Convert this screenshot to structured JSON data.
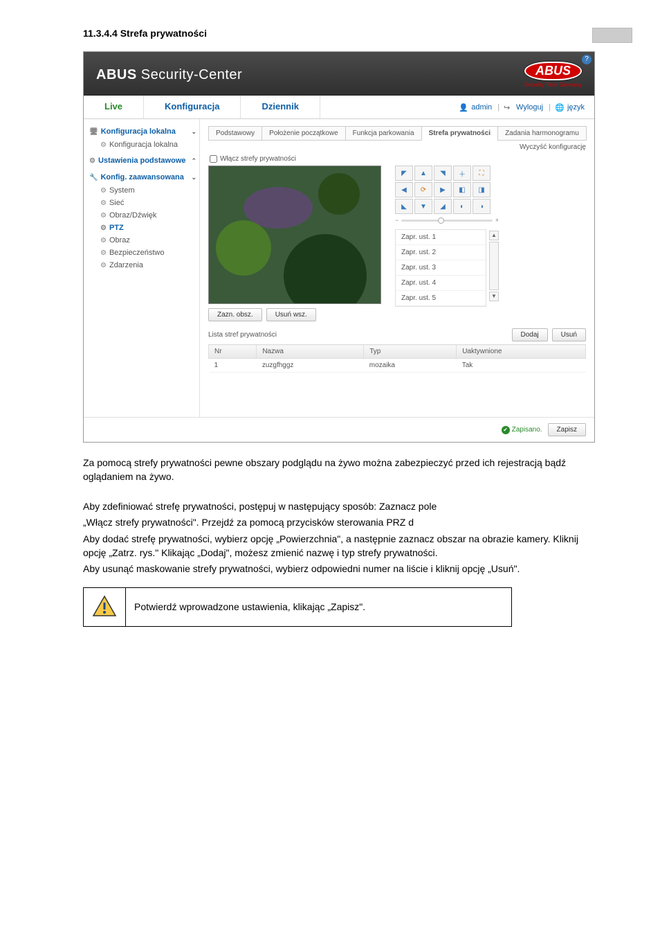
{
  "section_number": "11.3.4.4",
  "section_title": "Strefa prywatności",
  "app": {
    "brand_bold": "ABUS",
    "brand_rest": " Security-Center",
    "logo_text": "ABUS",
    "logo_sub": "Security Tech Germany"
  },
  "topnav": {
    "live": "Live",
    "config": "Konfiguracja",
    "journal": "Dziennik",
    "user": "admin",
    "logout": "Wyloguj",
    "language": "język"
  },
  "sidebar": {
    "local_cfg_head": "Konfiguracja lokalna",
    "local_cfg_item": "Konfiguracja lokalna",
    "basic_head": "Ustawienia podstawowe",
    "adv_head": "Konfig. zaawansowana",
    "adv_items": {
      "system": "System",
      "net": "Sieć",
      "imgsnd": "Obraz/Dźwięk",
      "ptz": "PTZ",
      "image": "Obraz",
      "security": "Bezpieczeństwo",
      "events": "Zdarzenia"
    }
  },
  "subtabs": {
    "basic": "Podstawowy",
    "initpos": "Położenie początkowe",
    "park": "Funkcja parkowania",
    "privacy": "Strefa prywatności",
    "schedule": "Zadania harmonogramu"
  },
  "buttons": {
    "clear_conf": "Wyczyść konfigurację",
    "enable_privacy": "Włącz strefy prywatności",
    "mark_area": "Zazn. obsz.",
    "delete_all": "Usuń wsz.",
    "add": "Dodaj",
    "delete": "Usuń",
    "save": "Zapisz",
    "saved": "Zapisano."
  },
  "presets": {
    "title": "Zapr. ust.",
    "items": [
      "Zapr. ust. 1",
      "Zapr. ust. 2",
      "Zapr. ust. 3",
      "Zapr. ust. 4",
      "Zapr. ust. 5"
    ]
  },
  "priv_list": {
    "title": "Lista stref prywatności",
    "cols": {
      "nr": "Nr",
      "name": "Nazwa",
      "type": "Typ",
      "enabled": "Uaktywnione"
    },
    "rows": [
      {
        "nr": "1",
        "name": "zuzgfhggz",
        "type": "mozaika",
        "enabled": "Tak"
      }
    ]
  },
  "body": {
    "p1": "Za pomocą strefy prywatności pewne obszary podglądu na żywo można zabezpieczyć przed ich rejestracją bądź oglądaniem na żywo.",
    "p2": "Aby zdefiniować strefę prywatności, postępuj w następujący sposób: Zaznacz pole",
    "p3": "„Włącz strefy prywatności\". Przejdź za pomocą przycisków sterowania PRZ d",
    "p4": "Aby dodać strefę prywatności, wybierz opcję „Powierzchnia\", a następnie zaznacz obszar na obrazie kamery. Kliknij opcję „Zatrz. rys.\" Klikając „Dodaj\", możesz zmienić nazwę i typ strefy prywatności.",
    "p5": "Aby usunąć maskowanie strefy prywatności, wybierz odpowiedni numer na liście i kliknij opcję „Usuń\".",
    "note": "Potwierdź wprowadzone ustawienia, klikając „Zapisz\"."
  }
}
